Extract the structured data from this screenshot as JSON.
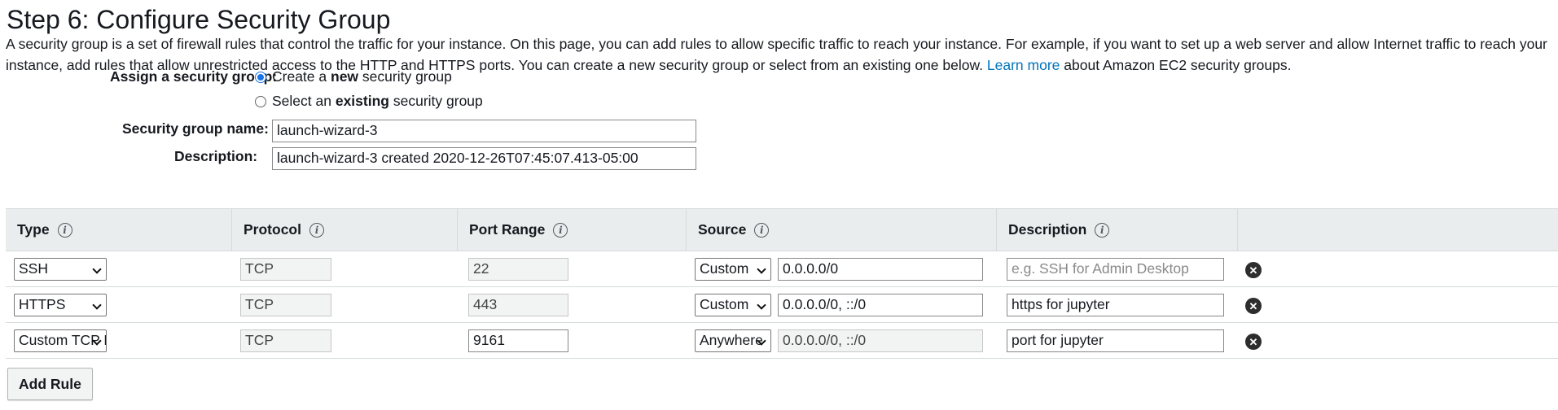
{
  "page": {
    "title": "Step 6: Configure Security Group",
    "intro_text": "A security group is a set of firewall rules that control the traffic for your instance. On this page, you can add rules to allow specific traffic to reach your instance. For example, if you want to set up a web server and allow Internet traffic to reach your instance, add rules that allow unrestricted access to the HTTP and HTTPS ports. You can create a new security group or select from an existing one below.",
    "learn_more_link": "Learn more",
    "intro_suffix": "about Amazon EC2 security groups."
  },
  "assign": {
    "label": "Assign a security group:",
    "option_new_prefix": "Create a",
    "option_new_bold": "new",
    "option_new_suffix": "security group",
    "option_existing_prefix": "Select an",
    "option_existing_bold": "existing",
    "option_existing_suffix": "security group",
    "selected": "new"
  },
  "form": {
    "name_label": "Security group name:",
    "name_value": "launch-wizard-3",
    "description_label": "Description:",
    "description_value": "launch-wizard-3 created 2020-12-26T07:45:07.413-05:00"
  },
  "table": {
    "headers": {
      "type": "Type",
      "protocol": "Protocol",
      "port_range": "Port Range",
      "source": "Source",
      "description": "Description"
    },
    "info_icon_glyph": "i",
    "rows": [
      {
        "type": "SSH",
        "protocol": "TCP",
        "port": "22",
        "source_mode": "Custom",
        "source_value": "0.0.0.0/0",
        "description": "",
        "description_placeholder": "e.g. SSH for Admin Desktop"
      },
      {
        "type": "HTTPS",
        "protocol": "TCP",
        "port": "443",
        "source_mode": "Custom",
        "source_value": "0.0.0.0/0, ::/0",
        "description": "https for jupyter",
        "description_placeholder": ""
      },
      {
        "type": "Custom TCP F",
        "protocol": "TCP",
        "port": "9161",
        "source_mode": "Anywhere",
        "source_value": "0.0.0.0/0, ::/0",
        "description": "port for jupyter",
        "description_placeholder": ""
      }
    ],
    "delete_glyph": "✕"
  },
  "actions": {
    "add_rule_label": "Add Rule"
  }
}
